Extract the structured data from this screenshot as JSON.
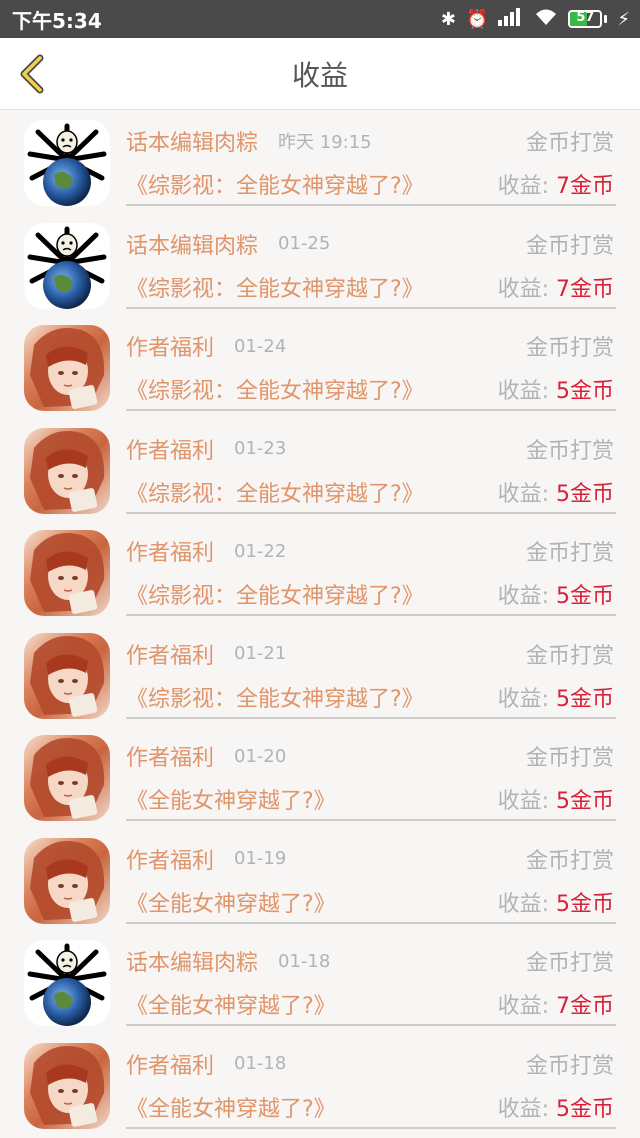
{
  "status": {
    "time": "下午5:34",
    "battery": "57",
    "battery_level": 0.57
  },
  "header": {
    "title": "收益"
  },
  "labels": {
    "earn_prefix": "收益:",
    "type": "金币打赏"
  },
  "colors": {
    "accent_orange": "#e0956a",
    "amount_red": "#d9223a",
    "gray_text": "#b3b3b3"
  },
  "items": [
    {
      "avatar": "editor",
      "name": "话本编辑肉粽",
      "time": "昨天 19:15",
      "type": "金币打赏",
      "book": "《综影视：全能女神穿越了?》",
      "earn_label": "收益:",
      "amount": "7金币"
    },
    {
      "avatar": "editor",
      "name": "话本编辑肉粽",
      "time": "01-25",
      "type": "金币打赏",
      "book": "《综影视：全能女神穿越了?》",
      "earn_label": "收益:",
      "amount": "7金币"
    },
    {
      "avatar": "author",
      "name": "作者福利",
      "time": "01-24",
      "type": "金币打赏",
      "book": "《综影视：全能女神穿越了?》",
      "earn_label": "收益:",
      "amount": "5金币"
    },
    {
      "avatar": "author",
      "name": "作者福利",
      "time": "01-23",
      "type": "金币打赏",
      "book": "《综影视：全能女神穿越了?》",
      "earn_label": "收益:",
      "amount": "5金币"
    },
    {
      "avatar": "author",
      "name": "作者福利",
      "time": "01-22",
      "type": "金币打赏",
      "book": "《综影视：全能女神穿越了?》",
      "earn_label": "收益:",
      "amount": "5金币"
    },
    {
      "avatar": "author",
      "name": "作者福利",
      "time": "01-21",
      "type": "金币打赏",
      "book": "《综影视：全能女神穿越了?》",
      "earn_label": "收益:",
      "amount": "5金币"
    },
    {
      "avatar": "author",
      "name": "作者福利",
      "time": "01-20",
      "type": "金币打赏",
      "book": "《全能女神穿越了?》",
      "earn_label": "收益:",
      "amount": "5金币"
    },
    {
      "avatar": "author",
      "name": "作者福利",
      "time": "01-19",
      "type": "金币打赏",
      "book": "《全能女神穿越了?》",
      "earn_label": "收益:",
      "amount": "5金币"
    },
    {
      "avatar": "editor",
      "name": "话本编辑肉粽",
      "time": "01-18",
      "type": "金币打赏",
      "book": "《全能女神穿越了?》",
      "earn_label": "收益:",
      "amount": "7金币"
    },
    {
      "avatar": "author",
      "name": "作者福利",
      "time": "01-18",
      "type": "金币打赏",
      "book": "《全能女神穿越了?》",
      "earn_label": "收益:",
      "amount": "5金币"
    }
  ]
}
